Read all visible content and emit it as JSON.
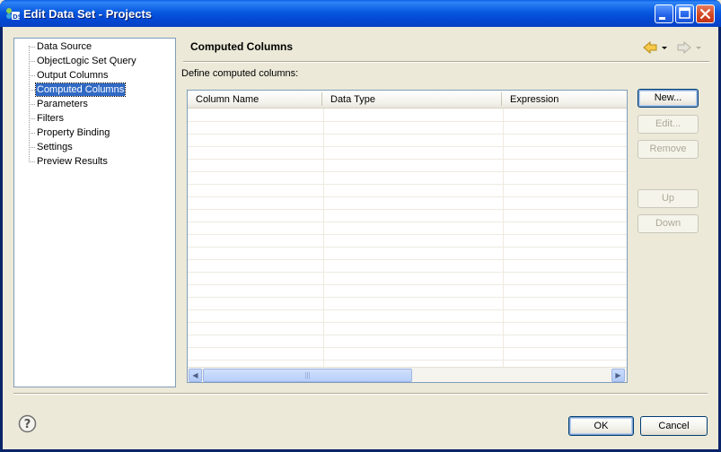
{
  "window": {
    "title": "Edit Data Set - Projects"
  },
  "tree": {
    "items": [
      "Data Source",
      "ObjectLogic Set Query",
      "Output Columns",
      "Computed Columns",
      "Parameters",
      "Filters",
      "Property Binding",
      "Settings",
      "Preview Results"
    ],
    "selected": "Computed Columns"
  },
  "main": {
    "heading": "Computed Columns",
    "define_label": "Define computed columns:"
  },
  "table": {
    "columns": [
      "Column Name",
      "Data Type",
      "Expression"
    ],
    "rows": []
  },
  "side_buttons": {
    "new": "New...",
    "edit": "Edit...",
    "remove": "Remove",
    "up": "Up",
    "down": "Down"
  },
  "footer": {
    "ok": "OK",
    "cancel": "Cancel"
  },
  "colors": {
    "selection": "#316ac5",
    "titlebar": "#0859e0"
  }
}
